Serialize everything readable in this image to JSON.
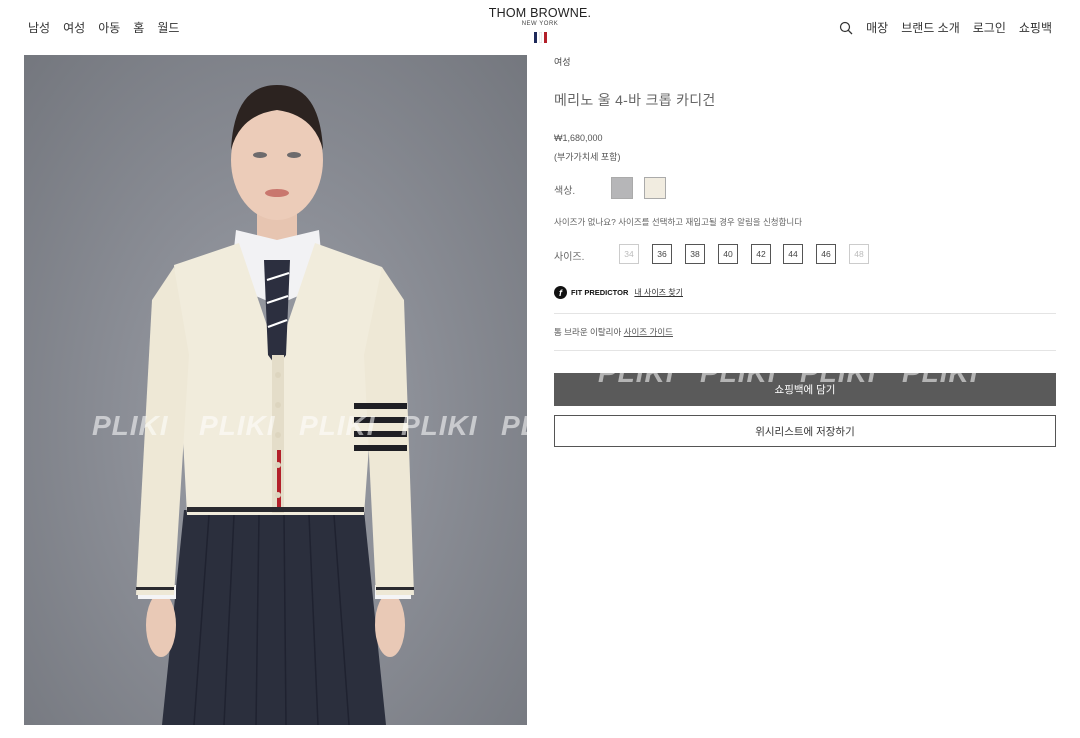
{
  "header": {
    "nav_left": [
      "남성",
      "여성",
      "아동",
      "홈",
      "월드"
    ],
    "logo": {
      "main": "THOM BROWNE.",
      "sub": "NEW YORK"
    },
    "flag_colors": [
      "#1e2a5a",
      "#ffffff",
      "#b3202a"
    ],
    "nav_right": [
      "매장",
      "브랜드 소개",
      "로그인",
      "쇼핑백"
    ]
  },
  "watermark": "PLIKI",
  "product": {
    "breadcrumb": "여성",
    "title": "메리노 울 4-바 크롭 카디건",
    "price": "₩1,680,000",
    "vat_note": "(부가가치세 포함)",
    "color_label": "색상.",
    "colors": [
      {
        "name": "grey",
        "hex": "#b6b6b8"
      },
      {
        "name": "ivory",
        "hex": "#f1ece0"
      }
    ],
    "size_note": "사이즈가 없나요? 사이즈를 선택하고 재입고될 경우 알림을 신청합니다",
    "size_label": "사이즈.",
    "sizes": [
      {
        "label": "34",
        "available": false
      },
      {
        "label": "36",
        "available": true
      },
      {
        "label": "38",
        "available": true
      },
      {
        "label": "40",
        "available": true
      },
      {
        "label": "42",
        "available": true
      },
      {
        "label": "44",
        "available": true
      },
      {
        "label": "46",
        "available": true
      },
      {
        "label": "48",
        "available": false
      }
    ],
    "fit_icon": "f",
    "fit_brand": "FIT PREDICTOR",
    "fit_link": "내 사이즈 찾기",
    "guide_text": "톰 브라운 이탈리아",
    "guide_link": "사이즈 가이드",
    "add_to_bag": "쇼핑백에 담기",
    "wishlist": "위시리스트에 저장하기"
  }
}
